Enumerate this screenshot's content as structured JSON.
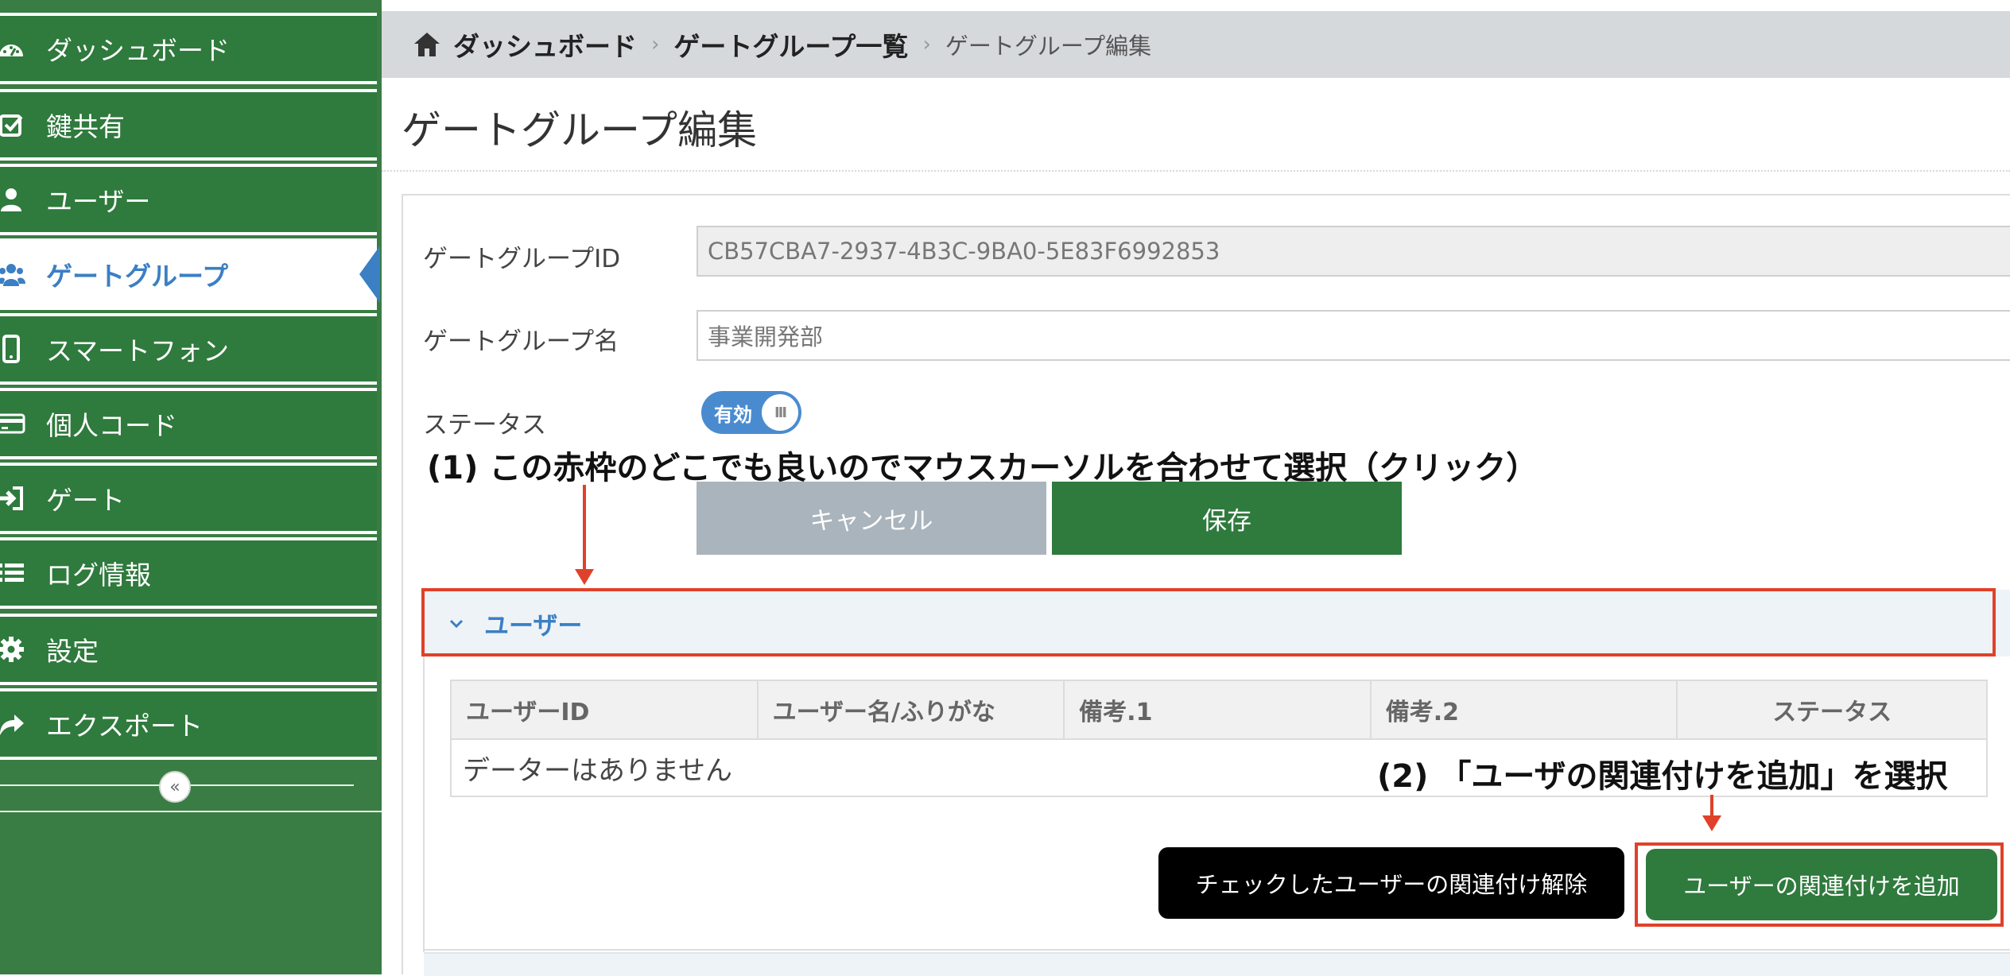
{
  "sidebar": {
    "items": [
      {
        "label": "ダッシュボード",
        "icon": "dashboard-icon"
      },
      {
        "label": "鍵共有",
        "icon": "checkbox-icon"
      },
      {
        "label": "ユーザー",
        "icon": "user-icon"
      },
      {
        "label": "ゲートグループ",
        "icon": "users-group-icon",
        "active": true
      },
      {
        "label": "スマートフォン",
        "icon": "smartphone-icon"
      },
      {
        "label": "個人コード",
        "icon": "credit-card-icon"
      },
      {
        "label": "ゲート",
        "icon": "sign-in-icon"
      },
      {
        "label": "ログ情報",
        "icon": "list-icon"
      },
      {
        "label": "設定",
        "icon": "gear-icon"
      },
      {
        "label": "エクスポート",
        "icon": "share-icon"
      }
    ],
    "collapse_label": "«"
  },
  "breadcrumb": {
    "items": [
      "ダッシュボード",
      "ゲートグループ一覧"
    ],
    "current": "ゲートグループ編集",
    "separator": "›"
  },
  "page": {
    "title": "ゲートグループ編集"
  },
  "form": {
    "id_label": "ゲートグループID",
    "id_value": "CB57CBA7-2937-4B3C-9BA0-5E83F6992853",
    "name_label": "ゲートグループ名",
    "name_value": "事業開発部",
    "status_label": "ステータス",
    "status_value": "有効",
    "toggle_knob": "III",
    "cancel_label": "キャンセル",
    "save_label": "保存"
  },
  "annotations": {
    "step1": "(1) この赤枠のどこでも良いのでマウスカーソルを合わせて選択（クリック）",
    "step2": "(2) 「ユーザの関連付けを追加」を選択"
  },
  "user_section": {
    "title": "ユーザー",
    "table": {
      "columns": [
        "ユーザーID",
        "ユーザー名/ふりがな",
        "備考.1",
        "備考.2",
        "ステータス"
      ],
      "empty_message": "データーはありません"
    },
    "unlink_label": "チェックしたユーザーの関連付け解除",
    "add_label": "ユーザーの関連付けを追加"
  },
  "colors": {
    "sidebar_green": "#2f7a3d",
    "accent_blue": "#3b7fc4",
    "annotation_red": "#e0412a"
  }
}
